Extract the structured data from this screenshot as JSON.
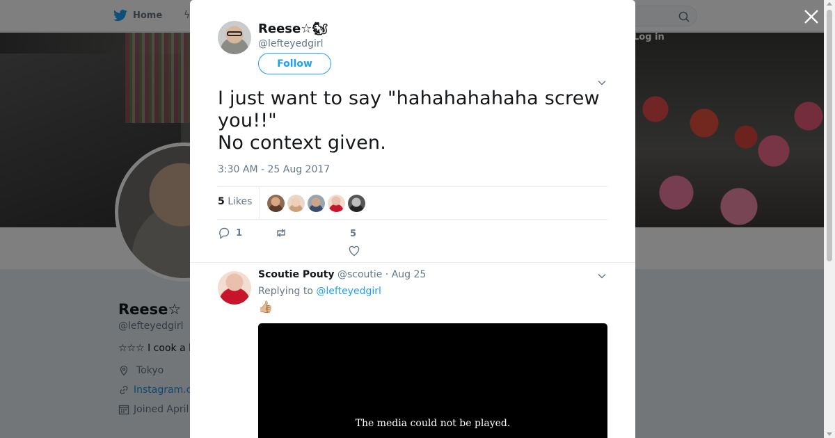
{
  "nav": {
    "home_label": "Home",
    "login_label": "Log in"
  },
  "profile": {
    "name": "Reese☆",
    "handle": "@lefteyedgirl",
    "bio": "☆☆☆ I cook a l",
    "location": "Tokyo",
    "link": "Instagram.c",
    "joined": "Joined April"
  },
  "tweet": {
    "author_name": "Reese☆🐿",
    "author_handle": "@lefteyedgirl",
    "follow_label": "Follow",
    "text_line1": "I just want to say \"hahahahahaha screw you!!\"",
    "text_line2": "No context given.",
    "timestamp": "3:30 AM - 25 Aug 2017",
    "likes_count": "5",
    "likes_label": "Likes",
    "reply_count": "1",
    "like_count_action": "5",
    "liker_colors": [
      "#6b4b3a",
      "#e8c4a8",
      "#7a8a9a",
      "#c23a3a",
      "#444444"
    ]
  },
  "reply": {
    "author_name": "Scoutie Pouty",
    "author_handle": "@scoutie",
    "separator": "·",
    "date": "Aug 25",
    "replying_to_label": "Replying to",
    "replying_to_handle": "@lefteyedgirl",
    "emoji": "👍🏼",
    "media_message": "The media could not be played."
  },
  "colors": {
    "accent": "#1da1f2",
    "text": "#14171a",
    "muted": "#657786"
  }
}
